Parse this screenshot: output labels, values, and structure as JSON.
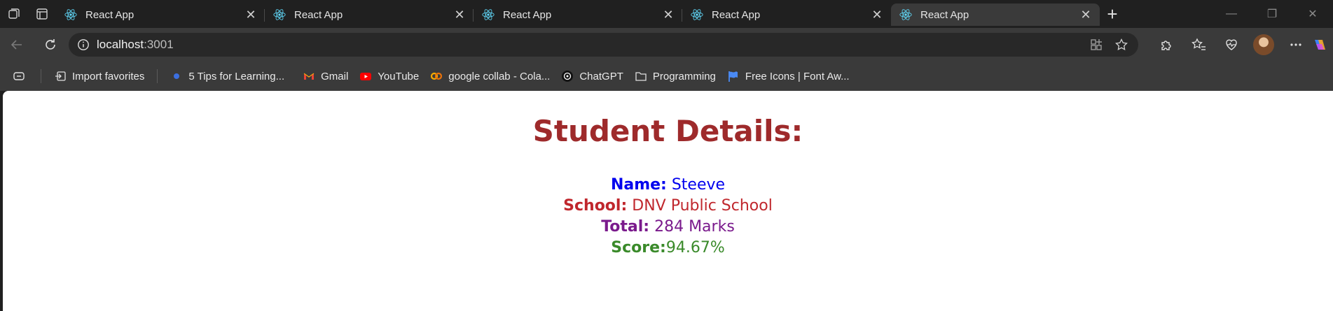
{
  "tabs": [
    {
      "title": "React App",
      "active": false
    },
    {
      "title": "React App",
      "active": false
    },
    {
      "title": "React App",
      "active": false
    },
    {
      "title": "React App",
      "active": false
    },
    {
      "title": "React App",
      "active": true
    }
  ],
  "address": {
    "host": "localhost",
    "port": ":3001"
  },
  "bookmarks": {
    "import": "Import favorites",
    "items": [
      {
        "label": "5 Tips for Learning...",
        "icon": "blue-dot-icon"
      },
      {
        "label": "Gmail",
        "icon": "gmail-icon"
      },
      {
        "label": "YouTube",
        "icon": "youtube-icon"
      },
      {
        "label": "google collab - Cola...",
        "icon": "colab-icon"
      },
      {
        "label": "ChatGPT",
        "icon": "chatgpt-icon"
      },
      {
        "label": "Programming",
        "icon": "folder-icon"
      },
      {
        "label": "Free Icons | Font Aw...",
        "icon": "flag-icon"
      }
    ]
  },
  "page": {
    "heading": "Student Details:",
    "name_label": "Name:",
    "name_value": "Steeve",
    "school_label": "School:",
    "school_value": "DNV Public School",
    "total_label": "Total:",
    "total_value": "284 Marks",
    "score_label": "Score:",
    "score_value": "94.67%"
  },
  "colors": {
    "heading": "#9e2a2b",
    "name": "#0000ee",
    "school": "#c0272d",
    "total": "#7a1a8c",
    "score": "#3a8a2a"
  }
}
